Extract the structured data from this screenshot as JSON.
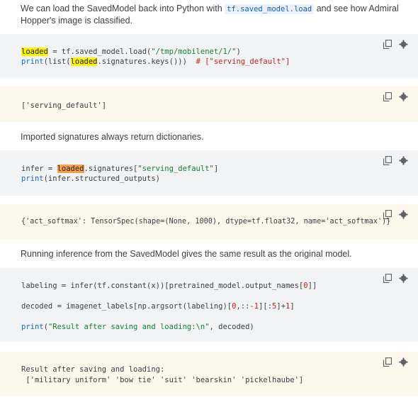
{
  "para1": {
    "text_before": "We can load the SavedModel back into Python with ",
    "code": "tf.saved_model.load",
    "text_after": " and see how Admiral Hopper's image is classified."
  },
  "code1": {
    "l1_var": "loaded",
    "l1_rest": " = tf.saved_model.load(",
    "l1_str": "\"/tmp/mobilenet/1/\"",
    "l1_end": ")",
    "l2_fn": "print",
    "l2_a": "(list(",
    "l2_var": "loaded",
    "l2_b": ".signatures.keys()))  ",
    "l2_cmt": "# [\"serving_default\"]"
  },
  "out1": {
    "l1": "['serving_default']"
  },
  "para2": {
    "text": "Imported signatures always return dictionaries."
  },
  "code2": {
    "l1_a": "infer = ",
    "l1_var": "loaded",
    "l1_b": ".signatures[",
    "l1_str": "\"serving_default\"",
    "l1_end": "]",
    "l2_fn": "print",
    "l2_rest": "(infer.structured_outputs)"
  },
  "out2": {
    "l1": "{'act_softmax': TensorSpec(shape=(None, 1000), dtype=tf.float32, name='act_softmax')}"
  },
  "para3": {
    "text": "Running inference from the SavedModel gives the same result as the original model."
  },
  "code3": {
    "l1_a": "labeling = infer(tf.constant(x))[pretrained_model.output_names[",
    "l1_num": "0",
    "l1_end": "]]",
    "l2_a": "decoded = imagenet_labels[np.argsort(labeling)[",
    "l2_n1": "0",
    "l2_b": ",::",
    "l2_n2": "-1",
    "l2_c": "][:",
    "l2_n3": "5",
    "l2_d": "]+",
    "l2_n4": "1",
    "l2_end": "]",
    "l3_fn": "print",
    "l3_a": "(",
    "l3_str": "\"Result after saving and loading:\\n\"",
    "l3_end": ", decoded)"
  },
  "out3": {
    "l1": "Result after saving and loading:",
    "l2": " ['military uniform' 'bow tie' 'suit' 'bearskin' 'pickelhaube']"
  },
  "icons": {
    "copy": "copy-icon",
    "settings": "settings-icon"
  },
  "colors": {
    "code_bg": "#f1f3f4",
    "output_bg": "#fef7ec",
    "highlight_yellow": "#fff200",
    "highlight_orange": "#f4a04a",
    "inline_code": "#1a5fb4"
  }
}
